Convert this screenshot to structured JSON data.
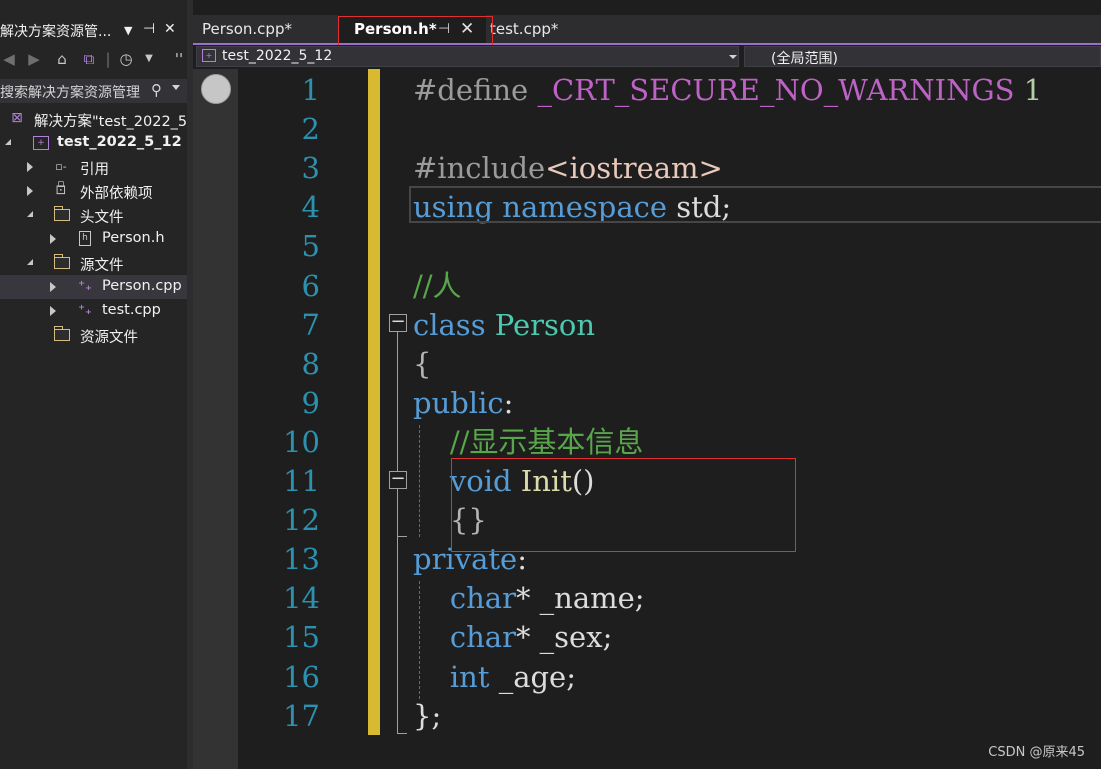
{
  "solution_explorer": {
    "title": "解决方案资源管...",
    "search_placeholder": "搜索解决方案资源管理",
    "tree": [
      {
        "label": "解决方案\"test_2022_5",
        "icon": "solution-icon",
        "bold": false
      },
      {
        "label": "test_2022_5_12",
        "icon": "project-icon",
        "bold": true
      },
      {
        "label": "引用",
        "icon": "references-icon"
      },
      {
        "label": "外部依赖项",
        "icon": "external-dependencies-icon"
      },
      {
        "label": "头文件",
        "icon": "folder-icon"
      },
      {
        "label": "Person.h",
        "icon": "header-file-icon"
      },
      {
        "label": "源文件",
        "icon": "folder-icon"
      },
      {
        "label": "Person.cpp",
        "icon": "cpp-file-icon",
        "selected": true
      },
      {
        "label": "test.cpp",
        "icon": "cpp-file-icon"
      },
      {
        "label": "资源文件",
        "icon": "folder-icon"
      }
    ]
  },
  "editor": {
    "tabs": [
      {
        "label": "Person.cpp*",
        "active": false
      },
      {
        "label": "Person.h*",
        "active": true
      },
      {
        "label": "test.cpp*",
        "active": false
      }
    ],
    "project_combo": "test_2022_5_12",
    "scope_combo": "(全局范围)",
    "line_numbers": [
      "1",
      "2",
      "3",
      "4",
      "5",
      "6",
      "7",
      "8",
      "9",
      "10",
      "11",
      "12",
      "13",
      "14",
      "15",
      "16",
      "17"
    ],
    "code_lines": [
      [
        {
          "t": "#define ",
          "c": "#9b9b9b"
        },
        {
          "t": "_CRT_SECURE_NO_WARNINGS",
          "c": "#bd63c5"
        },
        {
          "t": " 1",
          "c": "#b5cea8"
        }
      ],
      [],
      [
        {
          "t": "#include",
          "c": "#9b9b9b"
        },
        {
          "t": "<iostream>",
          "c": "#e8c9bb"
        }
      ],
      [
        {
          "t": "using",
          "c": "#569cd6"
        },
        {
          "t": " ",
          "c": "#dcdcdc"
        },
        {
          "t": "namespace",
          "c": "#569cd6"
        },
        {
          "t": " std;",
          "c": "#dcdcdc"
        }
      ],
      [],
      [
        {
          "t": "//人",
          "c": "#57a64a"
        }
      ],
      [
        {
          "t": "class",
          "c": "#569cd6"
        },
        {
          "t": " ",
          "c": "#dcdcdc"
        },
        {
          "t": "Person",
          "c": "#4ec9b0"
        }
      ],
      [
        {
          "t": "{",
          "c": "#b4b4b4"
        }
      ],
      [
        {
          "t": "public",
          "c": "#569cd6"
        },
        {
          "t": ":",
          "c": "#dcdcdc"
        }
      ],
      [
        {
          "t": "    //显示基本信息",
          "c": "#57a64a"
        }
      ],
      [
        {
          "t": "    ",
          "c": "#dcdcdc"
        },
        {
          "t": "void",
          "c": "#569cd6"
        },
        {
          "t": " ",
          "c": "#dcdcdc"
        },
        {
          "t": "Init",
          "c": "#dcdcaa"
        },
        {
          "t": "()",
          "c": "#dcdcdc"
        }
      ],
      [
        {
          "t": "    {}",
          "c": "#b4b4b4"
        }
      ],
      [
        {
          "t": "private",
          "c": "#569cd6"
        },
        {
          "t": ":",
          "c": "#dcdcdc"
        }
      ],
      [
        {
          "t": "    ",
          "c": "#dcdcdc"
        },
        {
          "t": "char",
          "c": "#569cd6"
        },
        {
          "t": "* _name;",
          "c": "#dcdcdc"
        }
      ],
      [
        {
          "t": "    ",
          "c": "#dcdcdc"
        },
        {
          "t": "char",
          "c": "#569cd6"
        },
        {
          "t": "* _sex;",
          "c": "#dcdcdc"
        }
      ],
      [
        {
          "t": "    ",
          "c": "#dcdcdc"
        },
        {
          "t": "int",
          "c": "#569cd6"
        },
        {
          "t": " _age;",
          "c": "#dcdcdc"
        }
      ],
      [
        {
          "t": "};",
          "c": "#dcdcdc"
        }
      ]
    ]
  },
  "watermark": "CSDN @原来45",
  "colors": {
    "accent": "#9b6fd1",
    "annotation_red": "#e03030",
    "change_bar": "#d7ba2f"
  }
}
